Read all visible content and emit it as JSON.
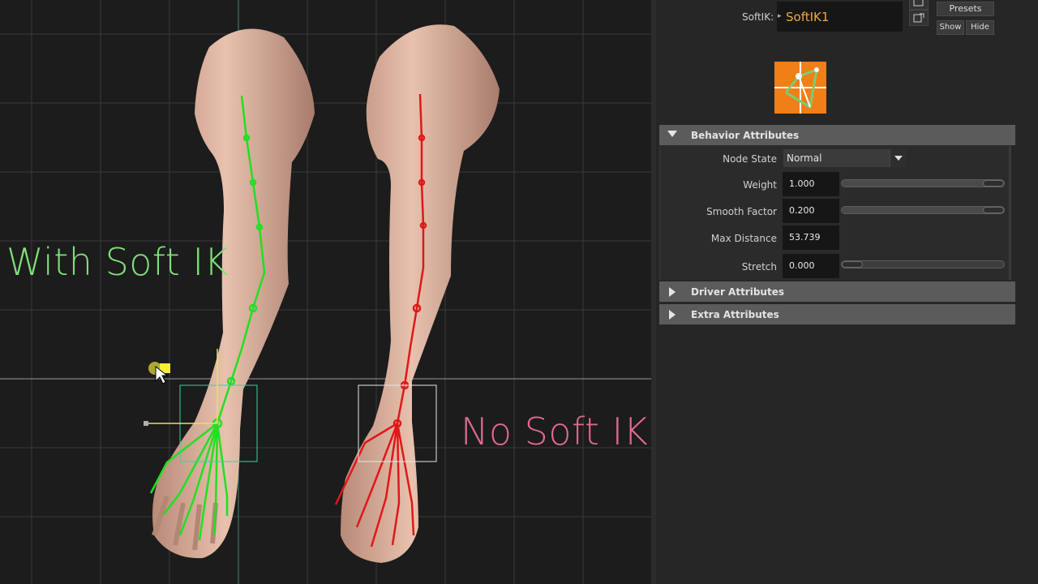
{
  "viewport": {
    "label_with": "With Soft IK",
    "label_without": "No Soft IK",
    "colors": {
      "with": "#7fe07a",
      "without": "#e06a8e",
      "joint_green": "#21e021",
      "joint_red": "#e01818"
    }
  },
  "header": {
    "node_type_label": "SoftIK:",
    "node_name": "SoftIK1",
    "presets_label": "Presets",
    "show_label": "Show",
    "hide_label": "Hide"
  },
  "logo": {
    "icon": "softik-node-icon",
    "colors": [
      "#f07f18",
      "#ffffff",
      "#7ecb6f"
    ]
  },
  "sections": {
    "behavior": {
      "title": "Behavior Attributes",
      "node_state": {
        "label": "Node State",
        "value": "Normal"
      },
      "weight": {
        "label": "Weight",
        "value": "1.000",
        "fraction": 1.0
      },
      "smooth_factor": {
        "label": "Smooth Factor",
        "value": "0.200",
        "fraction": 1.0
      },
      "max_distance": {
        "label": "Max Distance",
        "value": "53.739"
      },
      "stretch": {
        "label": "Stretch",
        "value": "0.000",
        "fraction": 0.0
      }
    },
    "driver": {
      "title": "Driver Attributes"
    },
    "extra": {
      "title": "Extra Attributes"
    }
  }
}
